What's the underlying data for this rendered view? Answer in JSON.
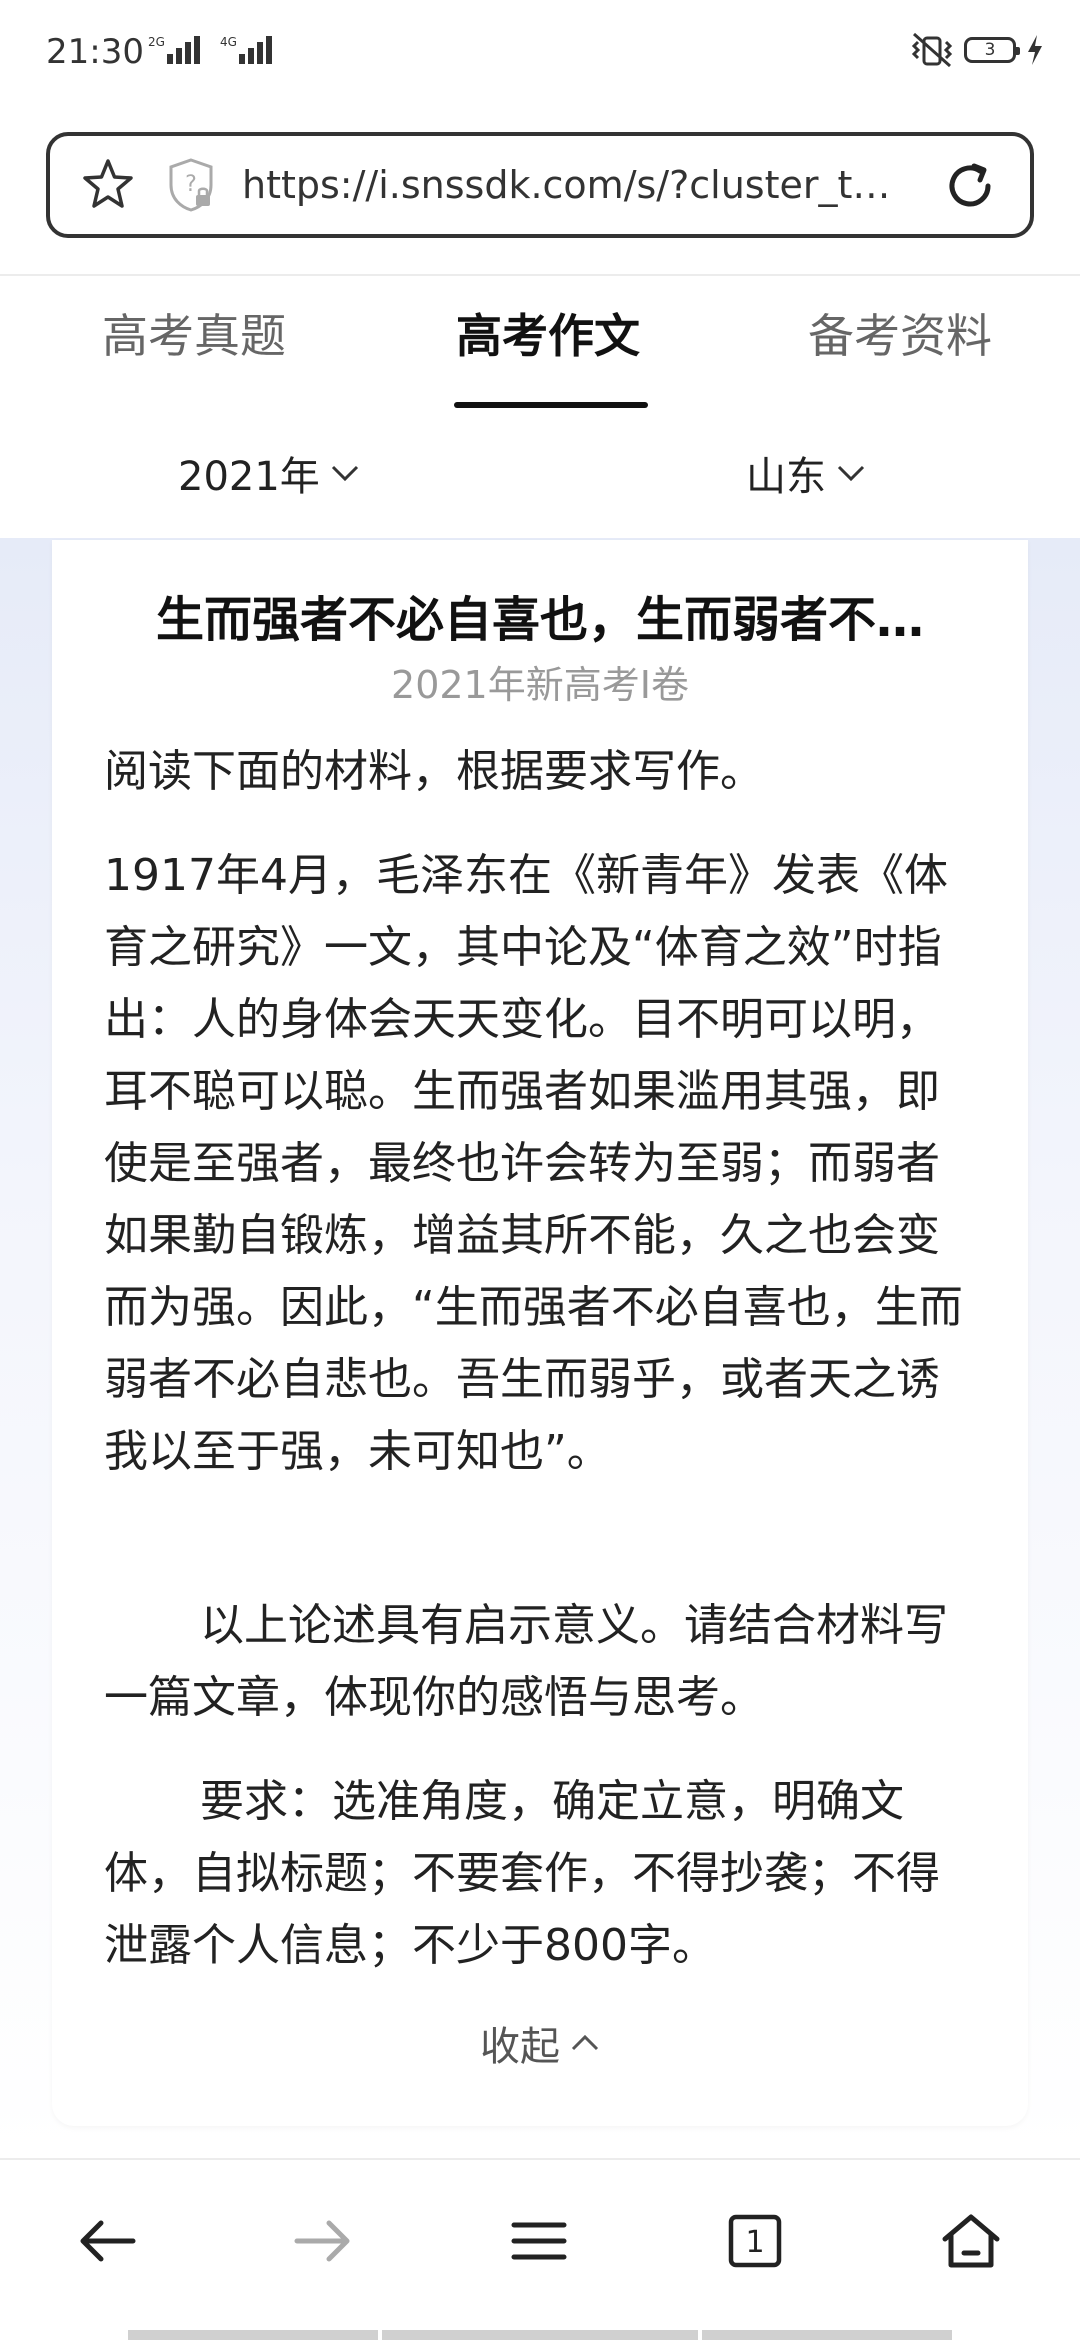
{
  "status_bar": {
    "time": "21:30",
    "network_1": "2G",
    "network_2": "4G",
    "battery_level": "3",
    "icons": [
      "signal-icon",
      "vibrate-icon",
      "battery-icon",
      "charging-icon"
    ]
  },
  "address_bar": {
    "url": "https://i.snssdk.com/s/?cluster_t…",
    "icons": [
      "star-icon",
      "shield-lock-icon",
      "reload-icon"
    ]
  },
  "tabs": [
    {
      "label": "高考真题",
      "active": false
    },
    {
      "label": "高考作文",
      "active": true
    },
    {
      "label": "备考资料",
      "active": false
    }
  ],
  "filters": {
    "year": "2021年",
    "region": "山东"
  },
  "card": {
    "title": "生而强者不必自喜也，生而弱者不…",
    "subtitle": "2021年新高考I卷",
    "paragraphs": [
      "阅读下面的材料，根据要求写作。",
      "1917年4月，毛泽东在《新青年》发表《体育之研究》一文，其中论及“体育之效”时指出：人的身体会天天变化。目不明可以明，耳不聪可以聪。生而强者如果滥用其强，即使是至强者，最终也许会转为至弱；而弱者如果勤自锻炼，增益其所不能，久之也会变而为强。因此，“生而强者不必自喜也，生而弱者不必自悲也。吾生而弱乎，或者天之诱我以至于强，未可知也”。",
      "以上论述具有启示意义。请结合材料写一篇文章，体现你的感悟与思考。",
      "要求：选准角度，确定立意，明确文体，自拟标题；不要套作，不得抄袭；不得泄露个人信息；不少于800字。"
    ],
    "collapse_label": "收起"
  },
  "bottom_nav": {
    "tab_count": "1",
    "icons": [
      "back-arrow-icon",
      "forward-arrow-icon",
      "menu-icon",
      "tabs-icon",
      "home-icon"
    ]
  },
  "colors": {
    "text": "#222222",
    "muted": "#999999",
    "content_gradient_top": "#e6ebf8"
  }
}
